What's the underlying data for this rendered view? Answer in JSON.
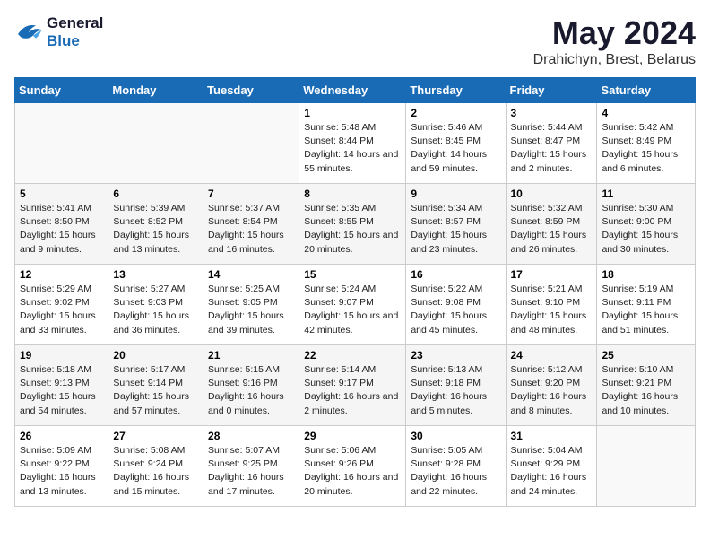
{
  "logo": {
    "line1": "General",
    "line2": "Blue"
  },
  "title": "May 2024",
  "location": "Drahichyn, Brest, Belarus",
  "days_of_week": [
    "Sunday",
    "Monday",
    "Tuesday",
    "Wednesday",
    "Thursday",
    "Friday",
    "Saturday"
  ],
  "weeks": [
    [
      null,
      null,
      null,
      {
        "day": "1",
        "sunrise": "5:48 AM",
        "sunset": "8:44 PM",
        "daylight": "14 hours and 55 minutes."
      },
      {
        "day": "2",
        "sunrise": "5:46 AM",
        "sunset": "8:45 PM",
        "daylight": "14 hours and 59 minutes."
      },
      {
        "day": "3",
        "sunrise": "5:44 AM",
        "sunset": "8:47 PM",
        "daylight": "15 hours and 2 minutes."
      },
      {
        "day": "4",
        "sunrise": "5:42 AM",
        "sunset": "8:49 PM",
        "daylight": "15 hours and 6 minutes."
      }
    ],
    [
      {
        "day": "5",
        "sunrise": "5:41 AM",
        "sunset": "8:50 PM",
        "daylight": "15 hours and 9 minutes."
      },
      {
        "day": "6",
        "sunrise": "5:39 AM",
        "sunset": "8:52 PM",
        "daylight": "15 hours and 13 minutes."
      },
      {
        "day": "7",
        "sunrise": "5:37 AM",
        "sunset": "8:54 PM",
        "daylight": "15 hours and 16 minutes."
      },
      {
        "day": "8",
        "sunrise": "5:35 AM",
        "sunset": "8:55 PM",
        "daylight": "15 hours and 20 minutes."
      },
      {
        "day": "9",
        "sunrise": "5:34 AM",
        "sunset": "8:57 PM",
        "daylight": "15 hours and 23 minutes."
      },
      {
        "day": "10",
        "sunrise": "5:32 AM",
        "sunset": "8:59 PM",
        "daylight": "15 hours and 26 minutes."
      },
      {
        "day": "11",
        "sunrise": "5:30 AM",
        "sunset": "9:00 PM",
        "daylight": "15 hours and 30 minutes."
      }
    ],
    [
      {
        "day": "12",
        "sunrise": "5:29 AM",
        "sunset": "9:02 PM",
        "daylight": "15 hours and 33 minutes."
      },
      {
        "day": "13",
        "sunrise": "5:27 AM",
        "sunset": "9:03 PM",
        "daylight": "15 hours and 36 minutes."
      },
      {
        "day": "14",
        "sunrise": "5:25 AM",
        "sunset": "9:05 PM",
        "daylight": "15 hours and 39 minutes."
      },
      {
        "day": "15",
        "sunrise": "5:24 AM",
        "sunset": "9:07 PM",
        "daylight": "15 hours and 42 minutes."
      },
      {
        "day": "16",
        "sunrise": "5:22 AM",
        "sunset": "9:08 PM",
        "daylight": "15 hours and 45 minutes."
      },
      {
        "day": "17",
        "sunrise": "5:21 AM",
        "sunset": "9:10 PM",
        "daylight": "15 hours and 48 minutes."
      },
      {
        "day": "18",
        "sunrise": "5:19 AM",
        "sunset": "9:11 PM",
        "daylight": "15 hours and 51 minutes."
      }
    ],
    [
      {
        "day": "19",
        "sunrise": "5:18 AM",
        "sunset": "9:13 PM",
        "daylight": "15 hours and 54 minutes."
      },
      {
        "day": "20",
        "sunrise": "5:17 AM",
        "sunset": "9:14 PM",
        "daylight": "15 hours and 57 minutes."
      },
      {
        "day": "21",
        "sunrise": "5:15 AM",
        "sunset": "9:16 PM",
        "daylight": "16 hours and 0 minutes."
      },
      {
        "day": "22",
        "sunrise": "5:14 AM",
        "sunset": "9:17 PM",
        "daylight": "16 hours and 2 minutes."
      },
      {
        "day": "23",
        "sunrise": "5:13 AM",
        "sunset": "9:18 PM",
        "daylight": "16 hours and 5 minutes."
      },
      {
        "day": "24",
        "sunrise": "5:12 AM",
        "sunset": "9:20 PM",
        "daylight": "16 hours and 8 minutes."
      },
      {
        "day": "25",
        "sunrise": "5:10 AM",
        "sunset": "9:21 PM",
        "daylight": "16 hours and 10 minutes."
      }
    ],
    [
      {
        "day": "26",
        "sunrise": "5:09 AM",
        "sunset": "9:22 PM",
        "daylight": "16 hours and 13 minutes."
      },
      {
        "day": "27",
        "sunrise": "5:08 AM",
        "sunset": "9:24 PM",
        "daylight": "16 hours and 15 minutes."
      },
      {
        "day": "28",
        "sunrise": "5:07 AM",
        "sunset": "9:25 PM",
        "daylight": "16 hours and 17 minutes."
      },
      {
        "day": "29",
        "sunrise": "5:06 AM",
        "sunset": "9:26 PM",
        "daylight": "16 hours and 20 minutes."
      },
      {
        "day": "30",
        "sunrise": "5:05 AM",
        "sunset": "9:28 PM",
        "daylight": "16 hours and 22 minutes."
      },
      {
        "day": "31",
        "sunrise": "5:04 AM",
        "sunset": "9:29 PM",
        "daylight": "16 hours and 24 minutes."
      },
      null
    ]
  ],
  "labels": {
    "sunrise_prefix": "Sunrise: ",
    "sunset_prefix": "Sunset: ",
    "daylight_prefix": "Daylight: "
  }
}
